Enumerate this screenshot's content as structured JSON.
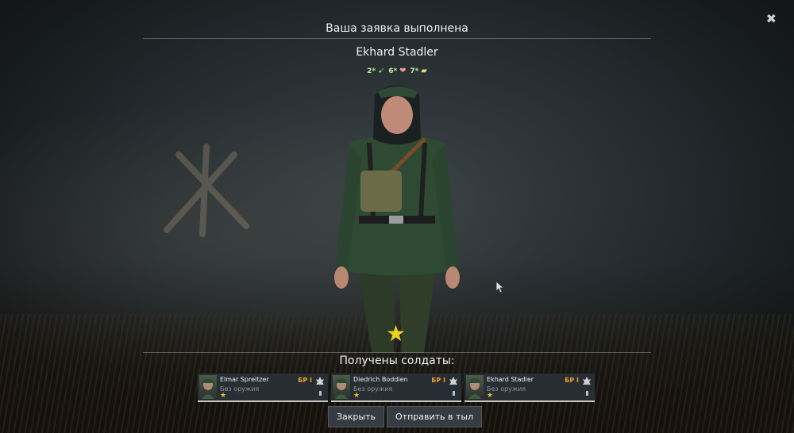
{
  "header": {
    "title": "Ваша заявка выполнена",
    "close_icon": "close-icon"
  },
  "soldier": {
    "name": "Ekhard Stadler",
    "stats": [
      {
        "value": "2*",
        "icon": "agility-icon",
        "color": "#7fd08a"
      },
      {
        "value": "6*",
        "icon": "heart-icon",
        "color": "#e89a9a"
      },
      {
        "value": "7*",
        "icon": "ammo-icon",
        "color": "#e8d87a"
      }
    ],
    "rank_icon": "star-icon"
  },
  "received": {
    "label": "Получены солдаты:",
    "cards": [
      {
        "name": "Elmar Spreitzer",
        "weapon": "Без оружия",
        "br": "БР I",
        "rank": "★",
        "class_icon": "rifleman-icon"
      },
      {
        "name": "Diedrich Boddien",
        "weapon": "Без оружия",
        "br": "БР I",
        "rank": "★",
        "class_icon": "rifleman-icon"
      },
      {
        "name": "Ekhard Stadler",
        "weapon": "Без оружия",
        "br": "БР I",
        "rank": "★",
        "class_icon": "rifleman-icon"
      }
    ]
  },
  "buttons": {
    "close": "Закрыть",
    "send_back": "Отправить в тыл"
  },
  "colors": {
    "accent_gold": "#e8d21c",
    "br_orange": "#f0a12a"
  }
}
